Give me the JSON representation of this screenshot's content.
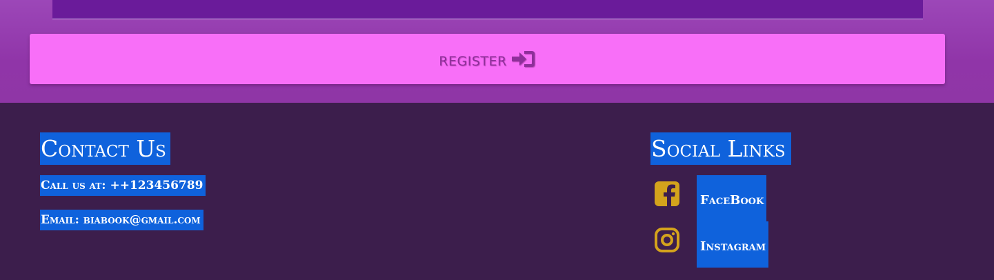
{
  "register": {
    "label": "Register",
    "icon": "sign-in-icon"
  },
  "contact": {
    "title": "Contact Us",
    "phone": "Call us at: ++123456789",
    "email": "Email: biabook@gmail.com"
  },
  "social": {
    "title": "Social Links",
    "links": [
      {
        "label": "FaceBook",
        "icon": "facebook-icon"
      },
      {
        "label": "Instagram",
        "icon": "instagram-icon"
      }
    ]
  },
  "colors": {
    "register_bg": "#f86ff8",
    "footer_bg": "#3c1e4c",
    "highlight": "#0f62dc",
    "icon_gold": "#d4a31c"
  }
}
